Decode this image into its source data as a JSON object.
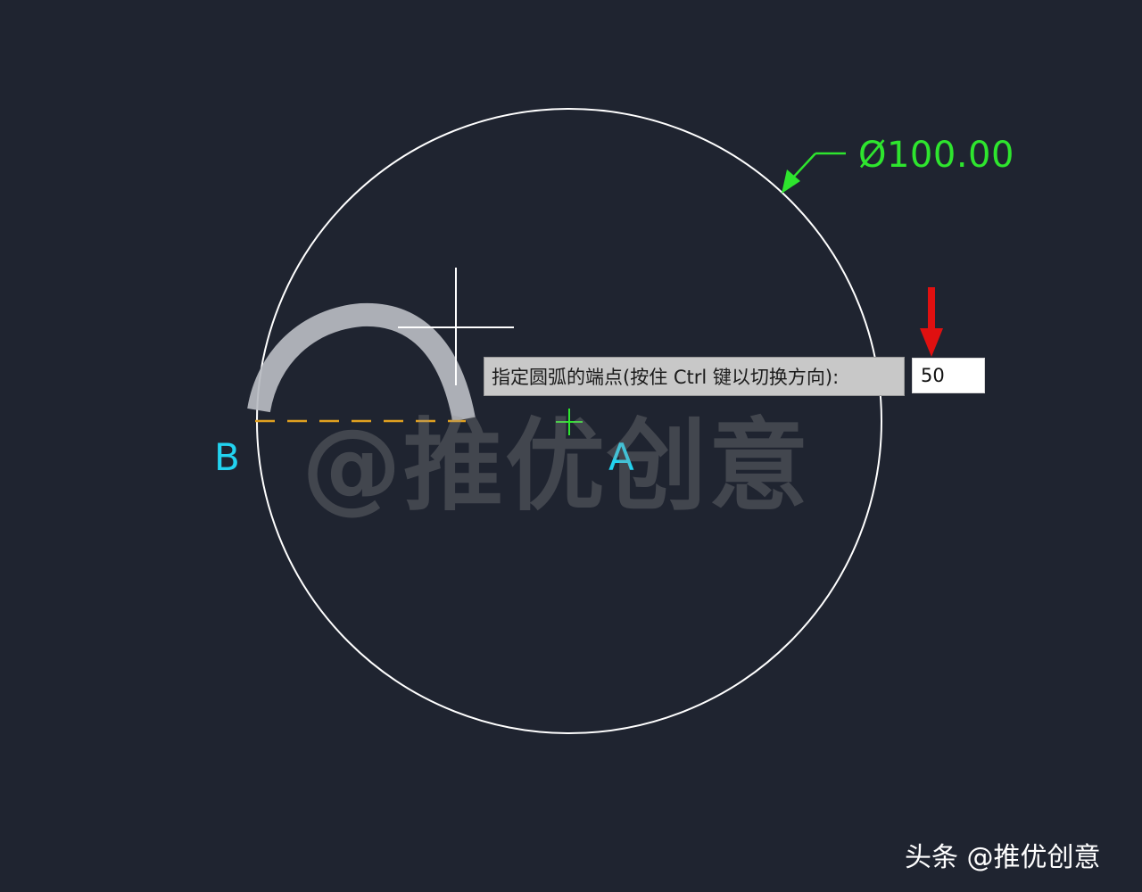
{
  "drawing": {
    "dimension_text": "Ø100.00",
    "point_b": "B",
    "point_a": "A"
  },
  "command_prompt": {
    "text": "指定圆弧的端点(按住 Ctrl 键以切换方向):",
    "input_value": "50"
  },
  "watermark": {
    "text": "@推优创意"
  },
  "footer": {
    "credit": "头条 @推优创意"
  },
  "colors": {
    "background": "#1f2430",
    "circle": "#ffffff",
    "dimension": "#2ee52e",
    "point_labels": "#22d3f0",
    "dashed_line": "#e0a020",
    "arrow_indicator": "#e01010"
  },
  "icons": {
    "crosshair": "crosshair-cursor-icon",
    "center_mark": "center-plus-icon",
    "arrow": "down-arrow-icon"
  }
}
